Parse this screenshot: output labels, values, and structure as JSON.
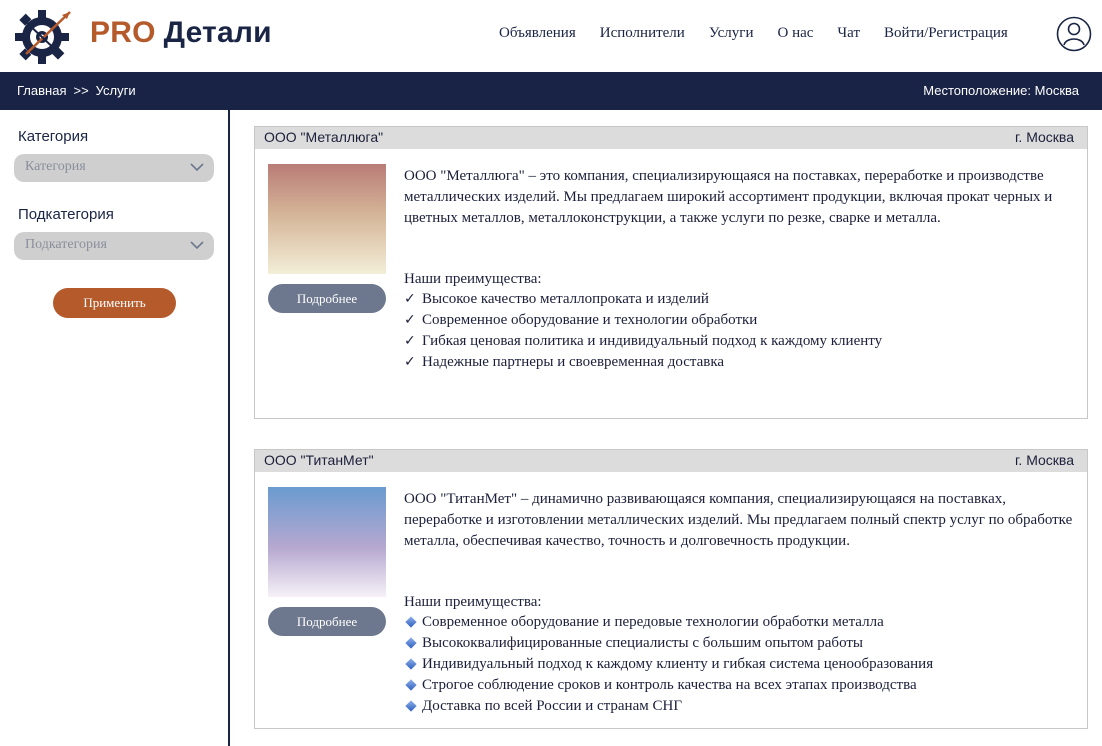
{
  "header": {
    "brand_pro": "PRO",
    "brand_rest": "Детали",
    "nav": [
      "Объявления",
      "Исполнители",
      "Услуги",
      "О нас",
      "Чат",
      "Войти/Регистрация"
    ]
  },
  "bar": {
    "crumbs": [
      "Главная",
      ">>",
      "Услуги"
    ],
    "location": "Местоположение: Москва"
  },
  "sidebar": {
    "category_label": "Категория",
    "category_value": "Категория",
    "subcategory_label": "Подкатегория",
    "subcategory_value": "Подкатегория",
    "apply": "Применить"
  },
  "cards": [
    {
      "name": "ООО \"Металлюга\"",
      "city": "г. Москва",
      "more": "Подробнее",
      "desc": "ООО \"Металлюга\" – это компания, специализирующаяся на поставках, переработке и производстве металлических изделий. Мы предлагаем широкий ассортимент продукции, включая прокат черных и цветных металлов, металлоконструкции, а также услуги по резке, сварке и металла.",
      "adv_title": "Наши преимущества:",
      "advantages": [
        "Высокое качество металлопроката и изделий",
        "Современное оборудование и технологии обработки",
        "Гибкая ценовая политика и индивидуальный подход к каждому клиенту",
        "Надежные партнеры и своевременная доставка"
      ]
    },
    {
      "name": "ООО \"ТитанМет\"",
      "city": "г. Москва",
      "more": "Подробнее",
      "desc": "ООО \"ТитанМет\" – динамично развивающаяся компания, специализирующаяся на поставках, переработке и изготовлении металлических изделий. Мы предлагаем полный спектр услуг по обработке металла, обеспечивая качество, точность и долговечность продукции.",
      "adv_title": "Наши преимущества:",
      "advantages": [
        "Современное оборудование и передовые технологии обработки металла",
        "Высококвалифицированные специалисты с большим опытом работы",
        "Индивидуальный подход к каждому клиенту и гибкая система ценообразования",
        "Строгое соблюдение сроков и контроль качества на всех этапах производства",
        "Доставка по всей России и странам СНГ"
      ]
    }
  ]
}
